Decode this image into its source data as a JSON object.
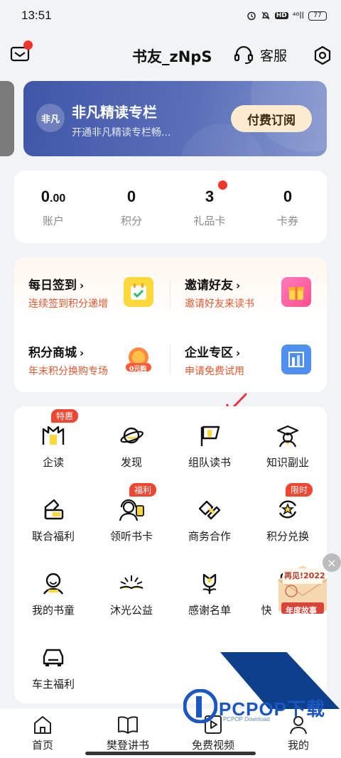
{
  "status_bar": {
    "time": "13:51",
    "signal": "⁴⁶ll",
    "battery": "77",
    "hd": "HD"
  },
  "header": {
    "title": "书友_zNpS",
    "service_label": "客服"
  },
  "banner": {
    "logo_text": "非凡",
    "title": "非凡精读专栏",
    "subtitle": "开通非凡精读专栏畅...",
    "button": "付费订阅"
  },
  "stats": [
    {
      "value_main": "0",
      "value_small": ".00",
      "label": "账户"
    },
    {
      "value_main": "0",
      "value_small": "",
      "label": "积分"
    },
    {
      "value_main": "3",
      "value_small": "",
      "label": "礼品卡"
    },
    {
      "value_main": "0",
      "value_small": "",
      "label": "卡券"
    }
  ],
  "tasks": [
    {
      "title": "每日签到",
      "subtitle": "连续签到积分递增",
      "icon": "calendar-check-icon"
    },
    {
      "title": "邀请好友",
      "subtitle": "邀请好友来读书",
      "icon": "gift-icon"
    },
    {
      "title": "积分商城",
      "subtitle": "年末积分换购专场",
      "icon": "coin-icon",
      "icon_text": "0元购"
    },
    {
      "title": "企业专区",
      "subtitle": "申请免费试用",
      "icon": "building-icon"
    }
  ],
  "grid": [
    {
      "label": "企读",
      "badge": "特惠",
      "icon": "enterprise-read-icon"
    },
    {
      "label": "发现",
      "badge": "",
      "icon": "planet-icon"
    },
    {
      "label": "组队读书",
      "badge": "",
      "icon": "flag-icon"
    },
    {
      "label": "知识副业",
      "badge": "",
      "icon": "graduate-icon"
    },
    {
      "label": "联合福利",
      "badge": "",
      "icon": "coupon-icon"
    },
    {
      "label": "领听书卡",
      "badge": "福利",
      "icon": "listen-card-icon"
    },
    {
      "label": "商务合作",
      "badge": "",
      "icon": "handshake-icon"
    },
    {
      "label": "积分兑换",
      "badge": "限时",
      "icon": "star-exchange-icon"
    },
    {
      "label": "我的书童",
      "badge": "",
      "icon": "assistant-icon"
    },
    {
      "label": "沐光公益",
      "badge": "",
      "icon": "sunlight-book-icon"
    },
    {
      "label": "感谢名单",
      "badge": "",
      "icon": "tulip-icon"
    },
    {
      "label": "快",
      "badge": "",
      "icon": "quick-icon"
    },
    {
      "label": "车主福利",
      "badge": "",
      "icon": "car-icon"
    }
  ],
  "promo": {
    "line1": "再见!2022",
    "line2": "年度故事",
    "close": "×"
  },
  "watermark": {
    "main": "PCPOP下载",
    "sub": "PCPOP Download"
  },
  "bottom_nav": [
    {
      "label": "首页",
      "icon": "home-icon"
    },
    {
      "label": "樊登讲书",
      "icon": "book-open-icon"
    },
    {
      "label": "免费视频",
      "icon": "play-icon"
    },
    {
      "label": "我的",
      "icon": "user-icon"
    }
  ],
  "colors": {
    "accent_red": "#f0362c",
    "banner_blue": "#4a5fae",
    "task_orange": "#e4572e"
  }
}
